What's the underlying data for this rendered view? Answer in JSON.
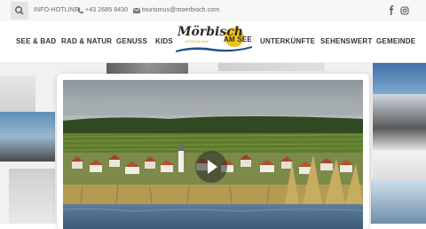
{
  "topbar": {
    "hotline_label": "INFO-HOTLINE",
    "phone": "+43 2685 8430",
    "email": "tourismus@moerbisch.com"
  },
  "nav": {
    "left_items": [
      "SEE & BAD",
      "RAD & NATUR",
      "GENUSS",
      "KIDS"
    ],
    "right_items": [
      "UNTERKÜNFTE",
      "SEHENSWERT",
      "GEMEINDE"
    ]
  },
  "logo": {
    "name": "Mörbisch",
    "suffix": "AM SEE",
    "tagline": "GEMEINSAM"
  },
  "icons": {
    "search": "search-icon",
    "phone": "phone-icon",
    "email": "envelope-icon",
    "facebook": "facebook-icon",
    "instagram": "instagram-icon",
    "play": "play-icon"
  }
}
